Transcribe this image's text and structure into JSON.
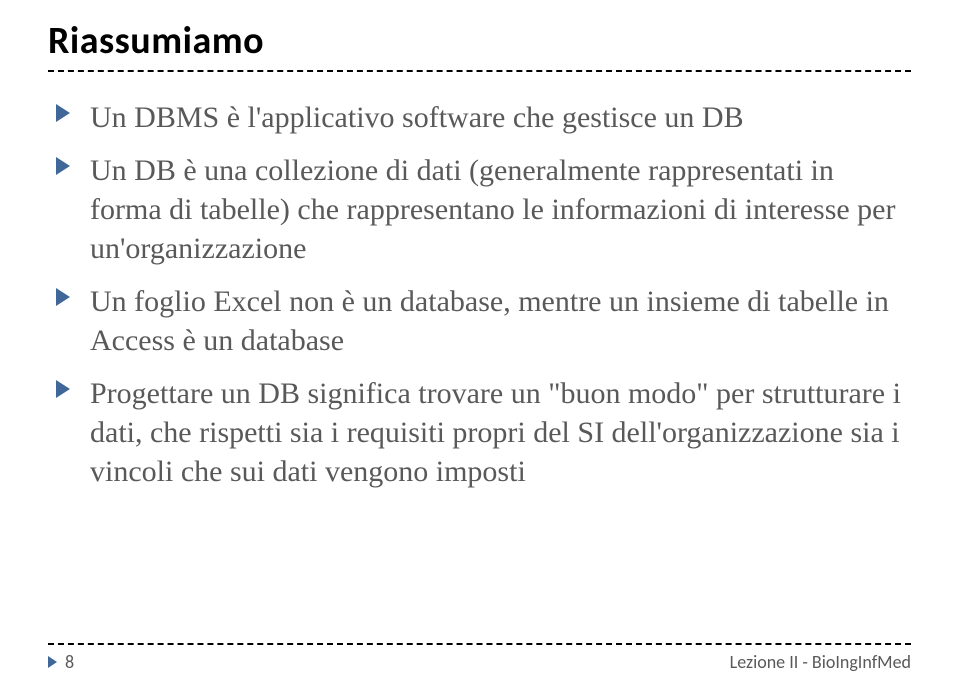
{
  "title": "Riassumiamo",
  "bullets": [
    "Un DBMS è l'applicativo software che gestisce un DB",
    "Un DB è una collezione di dati (generalmente rappresentati in forma di tabelle) che rappresentano le informazioni di interesse per un'organizzazione",
    "Un foglio Excel non è un database, mentre un insieme di tabelle in Access è un database",
    "Progettare un DB significa trovare un \"buon modo\" per strutturare i dati, che rispetti sia i requisiti propri del SI dell'organizzazione sia i vincoli che sui dati vengono imposti"
  ],
  "footer": {
    "page": "8",
    "label": "Lezione II - BioIngInfMed"
  }
}
